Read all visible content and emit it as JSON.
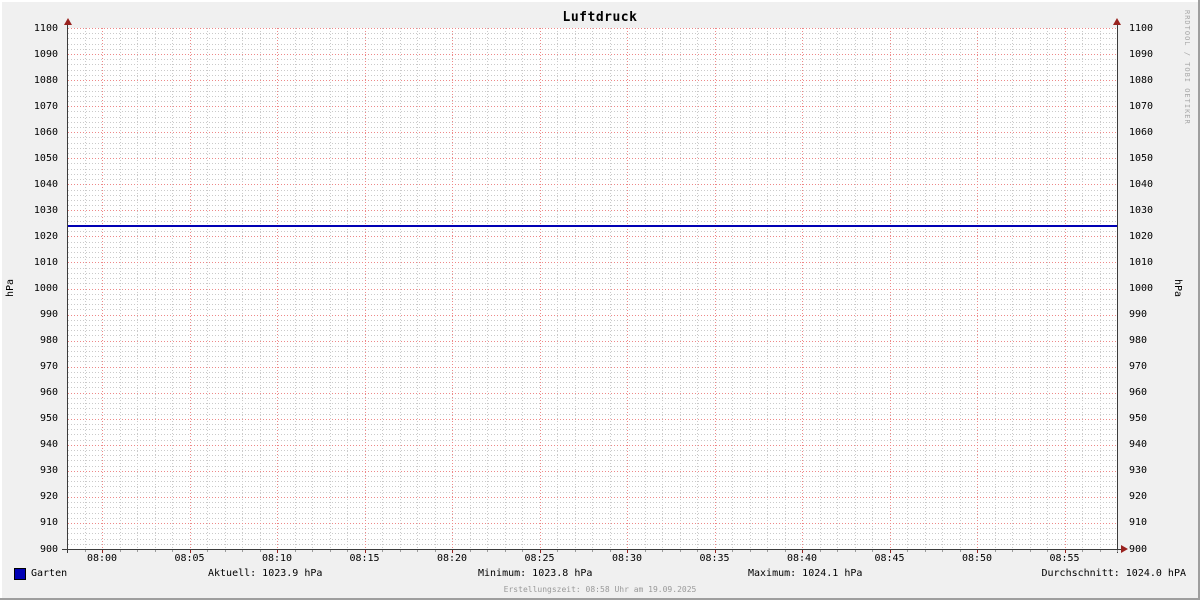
{
  "title": "Luftdruck",
  "watermark": "RRDTOOL / TOBI OETIKER",
  "footer": "Erstellungszeit: 08:58 Uhr am 19.09.2025",
  "legend": {
    "series_label": "Garten",
    "swatch_color": "#0000b4",
    "stats": [
      "Aktuell: 1023.9 hPa",
      "Minimum: 1023.8 hPa",
      "Maximum: 1024.1 hPa",
      "Durchschnitt: 1024.0 hPA"
    ]
  },
  "chart_data": {
    "type": "line",
    "title": "Luftdruck",
    "ylabel": "hPa",
    "ylabel_right": "hPa",
    "ylim": [
      900,
      1100
    ],
    "y_tick_step": 10,
    "y_minor_step": 2,
    "x_ticks": [
      "08:00",
      "08:05",
      "08:10",
      "08:15",
      "08:20",
      "08:25",
      "08:30",
      "08:35",
      "08:40",
      "08:45",
      "08:50",
      "08:55"
    ],
    "x_minor_per_major": 5,
    "grid": true,
    "legend_position": "bottom",
    "series": [
      {
        "name": "Garten",
        "color": "#0000b4",
        "approx_constant_value": 1024.0,
        "values_at_ticks": [
          1024.0,
          1024.0,
          1024.0,
          1024.0,
          1024.0,
          1024.0,
          1024.0,
          1024.0,
          1024.0,
          1024.0,
          1024.0,
          1024.0
        ]
      }
    ],
    "stats": {
      "aktuell_hPa": 1023.9,
      "minimum_hPa": 1023.8,
      "maximum_hPa": 1024.1,
      "durchschnitt_hPa": 1024.0
    },
    "colors": {
      "background": "#f0f0f0",
      "canvas": "#ffffff",
      "grid_major": "#ee8888",
      "grid_minor": "#cacaca",
      "axis": "#3c3c3c",
      "arrow": "#99221e",
      "text": "#000000",
      "muted_text": "#9a9a9a"
    }
  }
}
